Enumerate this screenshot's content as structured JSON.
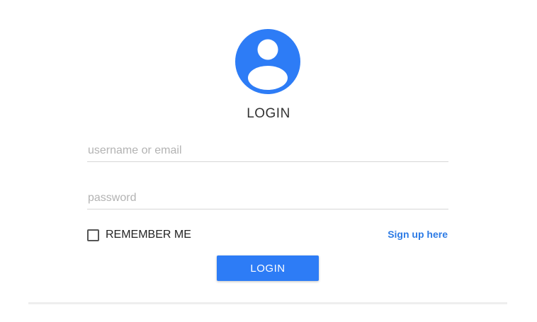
{
  "avatar": {
    "icon": "user-avatar-icon",
    "color": "#2d7cf6"
  },
  "form": {
    "title": "LOGIN",
    "username_placeholder": "username or email",
    "password_placeholder": "password",
    "remember_label": "REMEMBER ME",
    "remember_checked": false,
    "signup_label": "Sign up here",
    "login_button_label": "LOGIN"
  },
  "colors": {
    "accent": "#2d7cf6",
    "link": "#2d7be5"
  }
}
